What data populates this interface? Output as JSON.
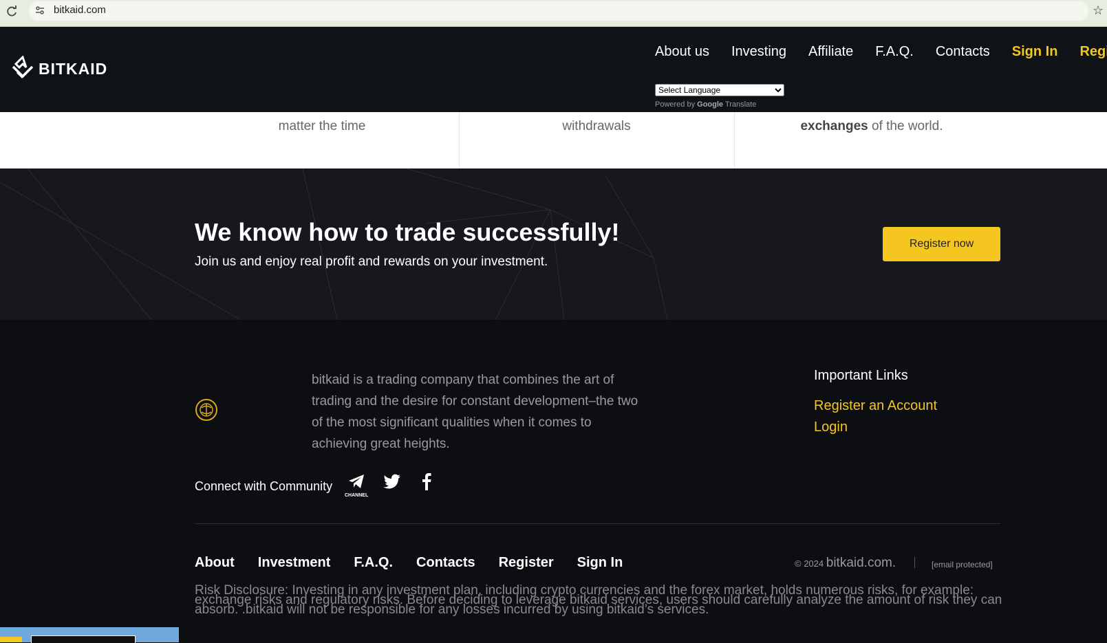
{
  "browser": {
    "url": "bitkaid.com"
  },
  "header": {
    "logo_text": "BITKAID",
    "nav": [
      {
        "label": "About us"
      },
      {
        "label": "Investing"
      },
      {
        "label": "Affiliate"
      },
      {
        "label": "F.A.Q."
      },
      {
        "label": "Contacts"
      },
      {
        "label": "Sign In"
      },
      {
        "label": "Regis"
      }
    ],
    "language_select": "Select Language",
    "powered_by": "Powered by",
    "google": "Google",
    "translate": "Translate"
  },
  "features": {
    "col1": "matter the time",
    "col2": "withdrawals",
    "col3_bold": "exchanges",
    "col3_rest": " of the world."
  },
  "cta": {
    "headline": "We know how to trade successfully!",
    "subtext": "Join us and enjoy real profit and rewards on your investment.",
    "button": "Register now"
  },
  "footer": {
    "about": "bitkaid is a trading company that combines the art of trading and the desire for constant development–the two of the most significant qualities when it comes to achieving great heights.",
    "links_title": "Important Links",
    "link_register": "Register an Account",
    "link_login": "Login",
    "community": "Connect with Community",
    "channel": "CHANNEL",
    "bottom_nav": [
      {
        "label": "About"
      },
      {
        "label": "Investment"
      },
      {
        "label": "F.A.Q."
      },
      {
        "label": "Contacts"
      },
      {
        "label": "Register"
      },
      {
        "label": "Sign In"
      }
    ],
    "copyright": "© 2024",
    "copyright_site": "bitkaid.com.",
    "email": "[email protected]",
    "risk": "Risk Disclosure: Investing in any investment plan, including crypto currencies and the forex market, holds numerous risks, for example: exchange risks and regulatory risks. Before deciding to leverage bitkaid services, users should carefully analyze the amount of risk they can absorb. .bitkaid will not be responsible for any losses incurred by using bitkaid’s services."
  },
  "colors": {
    "accent": "#f5c61f",
    "dark": "#0f1216",
    "cta_bg": "#16181d"
  }
}
